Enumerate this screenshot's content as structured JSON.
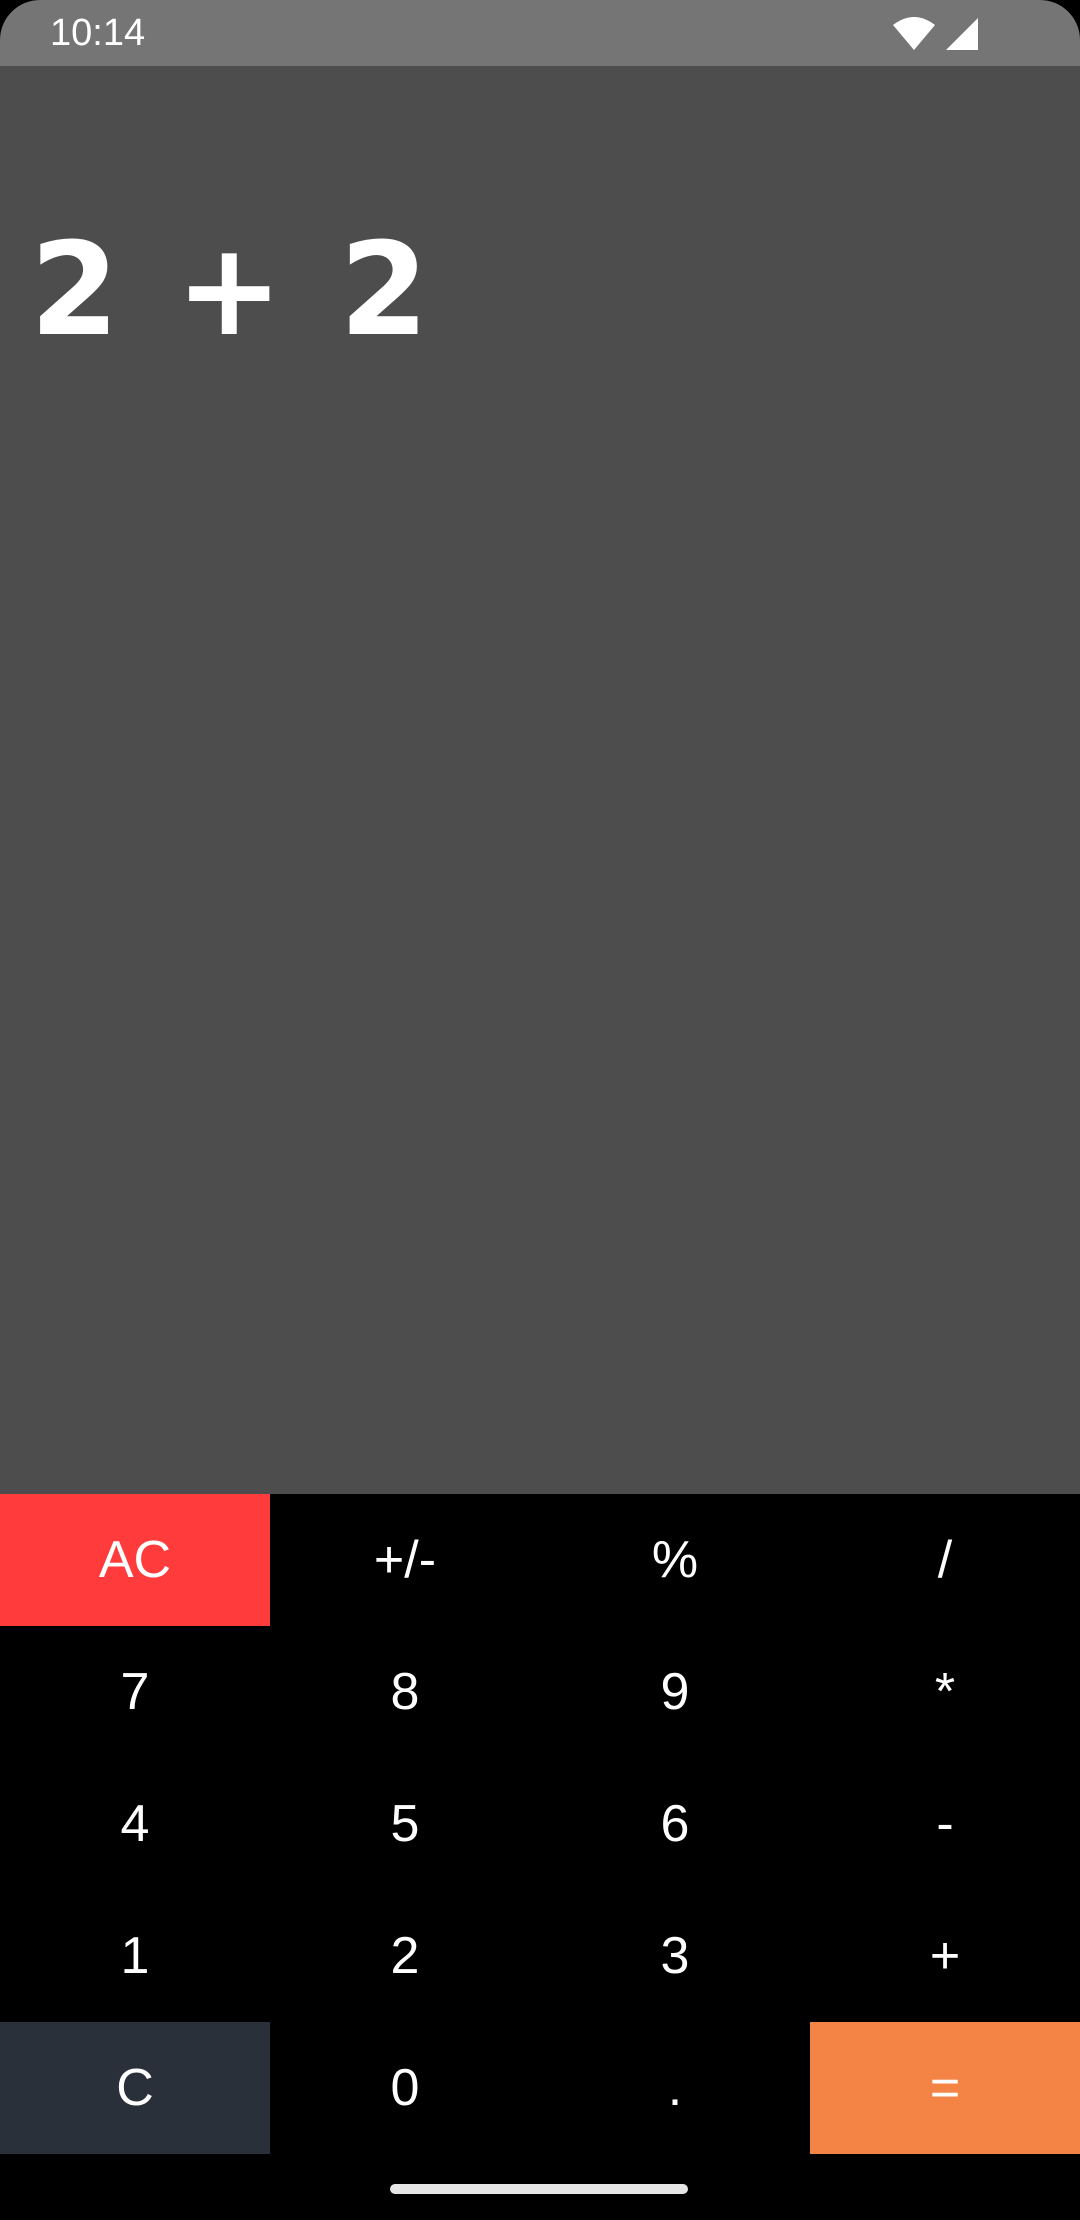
{
  "status_bar": {
    "time": "10:14",
    "icons": [
      "wifi-icon",
      "signal-icon"
    ]
  },
  "display": {
    "expression": "2 + 2"
  },
  "keypad": {
    "rows": [
      [
        {
          "label": "AC",
          "name": "all-clear-button"
        },
        {
          "label": "+/-",
          "name": "toggle-sign-button"
        },
        {
          "label": "%",
          "name": "percent-button"
        },
        {
          "label": "/",
          "name": "divide-button"
        }
      ],
      [
        {
          "label": "7",
          "name": "digit-7-button"
        },
        {
          "label": "8",
          "name": "digit-8-button"
        },
        {
          "label": "9",
          "name": "digit-9-button"
        },
        {
          "label": "*",
          "name": "multiply-button"
        }
      ],
      [
        {
          "label": "4",
          "name": "digit-4-button"
        },
        {
          "label": "5",
          "name": "digit-5-button"
        },
        {
          "label": "6",
          "name": "digit-6-button"
        },
        {
          "label": "-",
          "name": "subtract-button"
        }
      ],
      [
        {
          "label": "1",
          "name": "digit-1-button"
        },
        {
          "label": "2",
          "name": "digit-2-button"
        },
        {
          "label": "3",
          "name": "digit-3-button"
        },
        {
          "label": "+",
          "name": "add-button"
        }
      ],
      [
        {
          "label": "C",
          "name": "clear-button"
        },
        {
          "label": "0",
          "name": "digit-0-button"
        },
        {
          "label": ".",
          "name": "decimal-button"
        },
        {
          "label": "=",
          "name": "equals-button"
        }
      ]
    ]
  },
  "colors": {
    "status_bar_bg": "#757575",
    "display_bg": "#4d4d4d",
    "keypad_bg": "#000000",
    "ac_key": "#ff3b3b",
    "c_key": "#2a3039",
    "equals_key": "#f48446",
    "text": "#ffffff"
  }
}
